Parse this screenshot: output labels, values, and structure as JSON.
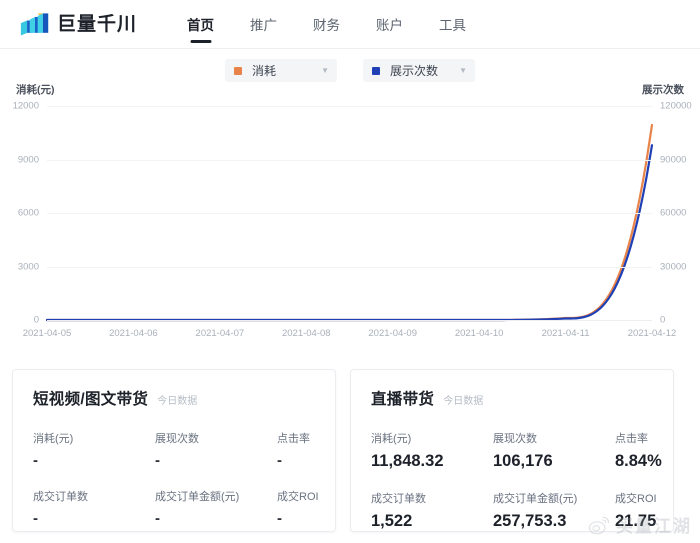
{
  "header": {
    "brand_name": "巨量千川",
    "logo_icon": "bar-chart-logo-icon",
    "nav": [
      {
        "label": "首页",
        "active": true
      },
      {
        "label": "推广",
        "active": false
      },
      {
        "label": "财务",
        "active": false
      },
      {
        "label": "账户",
        "active": false
      },
      {
        "label": "工具",
        "active": false
      }
    ]
  },
  "legend": {
    "selectors": [
      {
        "label": "消耗",
        "color": "#e8834a",
        "caret_icon": "chevron-down-icon"
      },
      {
        "label": "展示次数",
        "color": "#1f3fb5",
        "caret_icon": "chevron-down-icon"
      }
    ]
  },
  "chart_data": {
    "type": "line",
    "title": "",
    "xlabel": "",
    "ylabel": "消耗(元)",
    "y2label": "展示次数",
    "grid": true,
    "legend_position": "top-center",
    "x": [
      "2021-04-05",
      "2021-04-06",
      "2021-04-07",
      "2021-04-08",
      "2021-04-09",
      "2021-04-10",
      "2021-04-11",
      "2021-04-12"
    ],
    "yticks_left": [
      "0",
      "3000",
      "6000",
      "9000",
      "12000"
    ],
    "yticks_right": [
      "0",
      "30000",
      "60000",
      "90000",
      "120000"
    ],
    "ylim": [
      0,
      13000
    ],
    "y2lim": [
      0,
      130000
    ],
    "series": [
      {
        "name": "消耗",
        "color": "#e8834a",
        "axis": "left",
        "values": [
          0,
          0,
          0,
          0,
          0,
          0,
          120,
          11848.32
        ]
      },
      {
        "name": "展示次数",
        "color": "#1f3fb5",
        "axis": "right",
        "values": [
          0,
          0,
          0,
          0,
          0,
          0,
          900,
          106176
        ]
      }
    ]
  },
  "cards": [
    {
      "title": "短视频/图文带货",
      "tag": "今日数据",
      "metrics": [
        {
          "label": "消耗(元)",
          "value": "-"
        },
        {
          "label": "展现次数",
          "value": "-"
        },
        {
          "label": "点击率",
          "value": "-"
        },
        {
          "label": "成交订单数",
          "value": "-"
        },
        {
          "label": "成交订单金额(元)",
          "value": "-"
        },
        {
          "label": "成交ROI",
          "value": "-"
        }
      ]
    },
    {
      "title": "直播带货",
      "tag": "今日数据",
      "metrics": [
        {
          "label": "消耗(元)",
          "value": "11,848.32"
        },
        {
          "label": "展现次数",
          "value": "106,176"
        },
        {
          "label": "点击率",
          "value": "8.84%"
        },
        {
          "label": "成交订单数",
          "value": "1,522"
        },
        {
          "label": "成交订单金额(元)",
          "value": "257,753.3"
        },
        {
          "label": "成交ROI",
          "value": "21.75"
        }
      ]
    }
  ],
  "watermark": {
    "text": "买量江湖",
    "icon": "weibo-icon"
  }
}
